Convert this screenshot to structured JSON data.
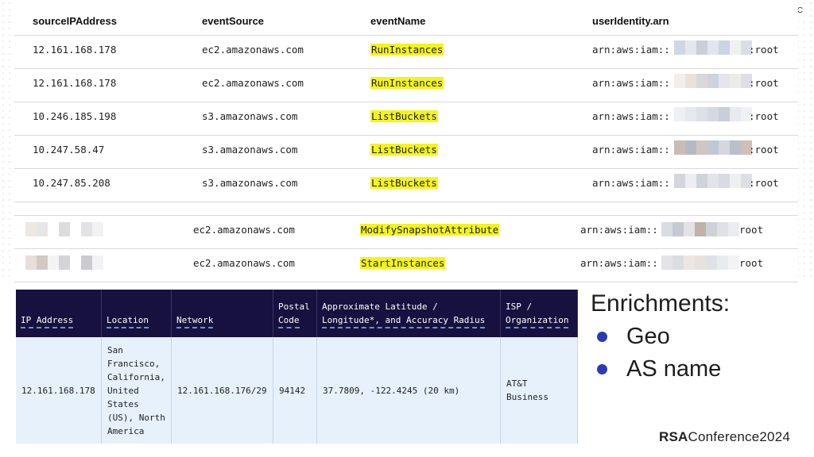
{
  "hashtag": "#RSAC",
  "columns": [
    "sourceIPAddress",
    "eventSource",
    "eventName",
    "userIdentity.arn"
  ],
  "rows": [
    {
      "ip": "12.161.168.178",
      "source": "ec2.amazonaws.com",
      "event": "RunInstances",
      "arn": "arn:aws:iam::",
      "suffix": ":root"
    },
    {
      "ip": "12.161.168.178",
      "source": "ec2.amazonaws.com",
      "event": "RunInstances",
      "arn": "arn:aws:iam::",
      "suffix": ":root"
    },
    {
      "ip": "10.246.185.198",
      "source": "s3.amazonaws.com",
      "event": "ListBuckets",
      "arn": "arn:aws:iam::",
      "suffix": ":root"
    },
    {
      "ip": "10.247.58.47",
      "source": "s3.amazonaws.com",
      "event": "ListBuckets",
      "arn": "arn:aws:iam::",
      "suffix": ":root"
    },
    {
      "ip": "10.247.85.208",
      "source": "s3.amazonaws.com",
      "event": "ListBuckets",
      "arn": "arn:aws:iam::",
      "suffix": ":root"
    }
  ],
  "rows2": [
    {
      "source": "ec2.amazonaws.com",
      "event": "ModifySnapshotAttribute",
      "arn": "arn:aws:iam::",
      "suffix": "root"
    },
    {
      "source": "ec2.amazonaws.com",
      "event": "StartInstances",
      "arn": "arn:aws:iam::",
      "suffix": "root"
    }
  ],
  "geo": {
    "headers": {
      "ip": "IP Address",
      "location": "Location",
      "network": "Network",
      "postal_1": "Postal",
      "postal_2": "Code",
      "latlon_1": "Approximate Latitude /",
      "latlon_2": "Longitude*, and Accuracy Radius",
      "isp_1": "ISP /",
      "isp_2": "Organization"
    },
    "row": {
      "ip": "12.161.168.178",
      "location_lines": [
        "San",
        "Francisco,",
        "California,",
        "United",
        "States",
        "(US), North",
        "America"
      ],
      "network": "12.161.168.176/29",
      "postal": "94142",
      "latlon": "37.7809, -122.4245 (20 km)",
      "isp_lines": [
        "AT&T",
        "Business"
      ]
    }
  },
  "enrichments": {
    "title": "Enrichments:",
    "items": [
      "Geo",
      "AS name"
    ]
  },
  "brand": {
    "bold": "RSA",
    "rest": "Conference",
    "year": "2024"
  },
  "colors": {
    "highlight": "#f4f41b",
    "header_bg": "#16113f",
    "cell_bg": "#e6f1fb",
    "bullet": "#2a39b8"
  }
}
